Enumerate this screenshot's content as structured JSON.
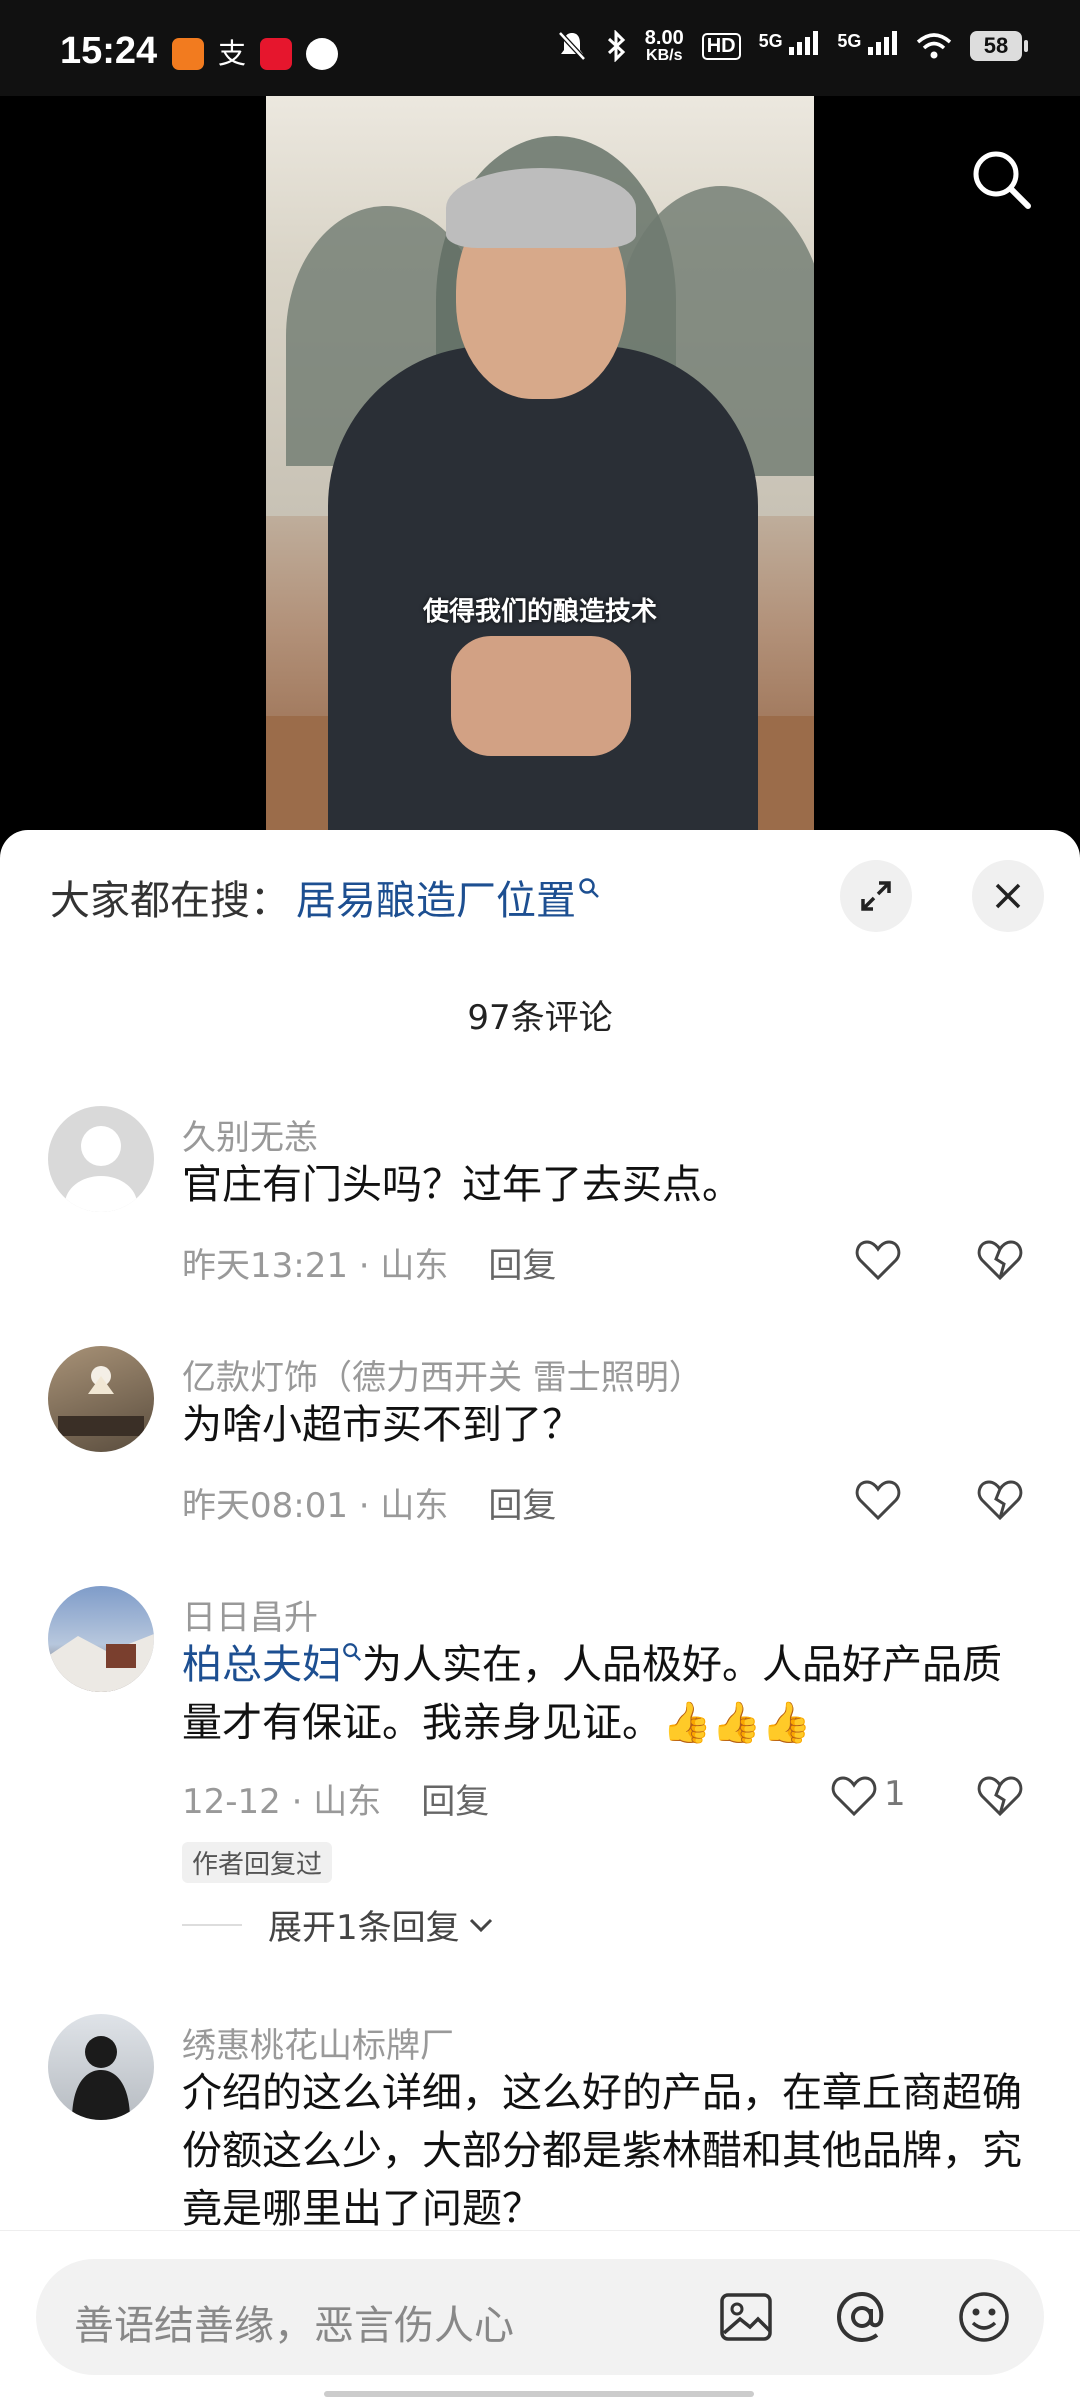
{
  "status_bar": {
    "time": "15:24",
    "net_speed_value": "8.00",
    "net_speed_unit": "KB/s",
    "hd_label": "HD",
    "signal1": "5G",
    "signal2": "5G",
    "battery": "58"
  },
  "video": {
    "subtitle": "使得我们的酿造技术"
  },
  "sheet": {
    "search_prefix": "大家都在搜：",
    "search_term": "居易酿造厂位置",
    "comment_count": "97条评论"
  },
  "comments": [
    {
      "user": "久别无恙",
      "text": "官庄有门头吗？过年了去买点。",
      "time": "昨天13:21 · 山东",
      "reply": "回复"
    },
    {
      "user": "亿款灯饰（德力西开关 雷士照明）",
      "text": "为啥小超市买不到了？",
      "time": "昨天08:01 · 山东",
      "reply": "回复"
    },
    {
      "user": "日日昌升",
      "mention": "柏总夫妇",
      "text": "为人实在，人品极好。人品好产品质量才有保证。我亲身见证。👍👍👍",
      "time": "12-12 · 山东",
      "reply": "回复",
      "likes": "1",
      "author_badge": "作者回复过",
      "expand": "展开1条回复"
    },
    {
      "user": "绣惠桃花山标牌厂",
      "text": "介绍的这么详细，这么好的产品，在章丘商超确份额这么少，大部分都是紫林醋和其他品牌，究竟是哪里出了问题？"
    }
  ],
  "input_bar": {
    "placeholder": "善语结善缘，恶言伤人心"
  },
  "colors": {
    "link": "#1d4f91",
    "muted": "#999999",
    "sheet_bg": "#ffffff"
  }
}
